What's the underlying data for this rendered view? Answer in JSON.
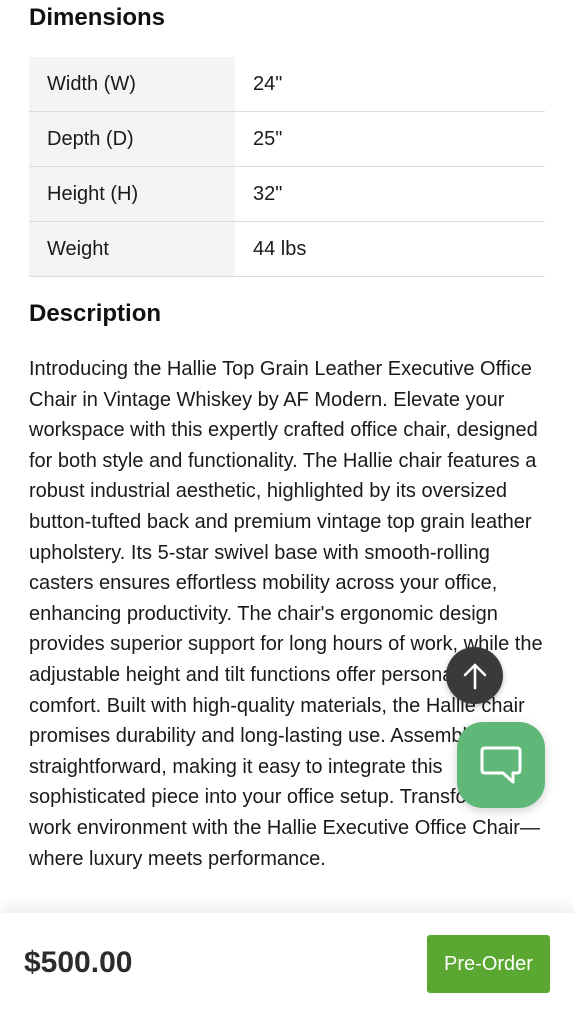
{
  "dimensions": {
    "title": "Dimensions",
    "rows": [
      {
        "label": "Width (W)",
        "value": "24\""
      },
      {
        "label": "Depth (D)",
        "value": "25\""
      },
      {
        "label": "Height (H)",
        "value": "32\""
      },
      {
        "label": "Weight",
        "value": "44 lbs"
      }
    ]
  },
  "description": {
    "title": "Description",
    "text": "Introducing the Hallie Top Grain Leather Executive Office Chair in Vintage Whiskey by AF Modern. Elevate your workspace with this expertly crafted office chair, designed for both style and functionality. The Hallie chair features a robust industrial aesthetic, highlighted by its oversized button-tufted back and premium vintage top grain leather upholstery. Its 5-star swivel base with smooth-rolling casters ensures effortless mobility across your office, enhancing productivity. The chair's ergonomic design provides superior support for long hours of work, while the adjustable height and tilt functions offer personalized comfort. Built with high-quality materials, the Hallie chair promises durability and long-lasting use. Assembly is straightforward, making it easy to integrate this sophisticated piece into your office setup. Transform your work environment with the Hallie Executive Office Chair—where luxury meets performance."
  },
  "floating": {
    "scroll_top_icon": "arrow-up-icon",
    "chat_icon": "chat-bubble-icon"
  },
  "purchase_bar": {
    "price": "$500.00",
    "button_label": "Pre-Order"
  },
  "colors": {
    "accent_green": "#5aa832",
    "chat_green": "#5fb878",
    "scroll_button": "#3a3a3a"
  }
}
